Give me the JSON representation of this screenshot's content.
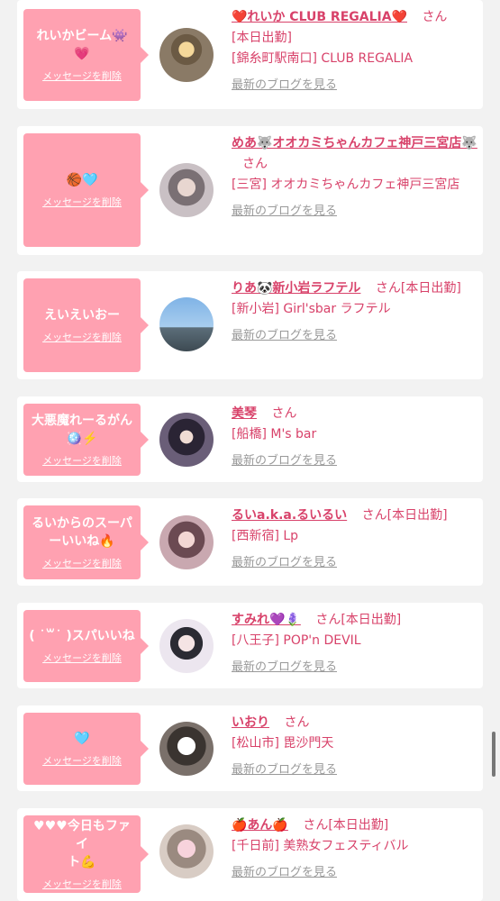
{
  "cards": [
    {
      "message": "れいかビーム👾\n💗",
      "delete": "メッセージを削除",
      "name": "❤️れいか CLUB REGALIA❤️",
      "san": "さん",
      "status": "",
      "extra": "[本日出勤]",
      "shop": "[錦糸町駅南口] CLUB REGALIA",
      "blog": "最新のブログを見る",
      "avatar": "avatar-1"
    },
    {
      "message": "🏀🩵",
      "delete": "メッセージを削除",
      "name": "めあ🐺オオカミちゃんカフェ神戸三宮店🐺",
      "san": "さん",
      "status": "",
      "extra": "",
      "shop": "[三宮] オオカミちゃんカフェ神戸三宮店",
      "blog": "最新のブログを見る",
      "avatar": "avatar-2"
    },
    {
      "message": "えいえいおー",
      "delete": "メッセージを削除",
      "name": "りあ🐼新小岩ラフテル",
      "san": "さん[本日出勤]",
      "status": "",
      "extra": "",
      "shop": "[新小岩] Girl'sbar ラフテル",
      "blog": "最新のブログを見る",
      "avatar": "avatar-3"
    },
    {
      "message": "大悪魔れーるがん\n🪩⚡️",
      "delete": "メッセージを削除",
      "name": "美琴",
      "san": "さん",
      "status": "",
      "extra": "",
      "shop": "[船橋] M's bar",
      "blog": "最新のブログを見る",
      "avatar": "avatar-4"
    },
    {
      "message": "るいからのスーパ\nーいいね🔥",
      "delete": "メッセージを削除",
      "name": "るいa.k.a.るいるい",
      "san": "さん[本日出勤]",
      "status": "",
      "extra": "",
      "shop": "[西新宿] Lp",
      "blog": "最新のブログを見る",
      "avatar": "avatar-5"
    },
    {
      "message": "( ˙꒳˙ )スパいいね",
      "delete": "メッセージを削除",
      "name": "すみれ💜🪻",
      "san": "さん[本日出勤]",
      "status": "",
      "extra": "",
      "shop": "[八王子] POP'n DEVIL",
      "blog": "最新のブログを見る",
      "avatar": "avatar-6"
    },
    {
      "message": "🩵",
      "delete": "メッセージを削除",
      "name": "いおり",
      "san": "さん",
      "status": "",
      "extra": "",
      "shop": "[松山市] 毘沙門天",
      "blog": "最新のブログを見る",
      "avatar": "avatar-7"
    },
    {
      "message": "♥♥♥今日もファイ\nト💪",
      "delete": "メッセージを削除",
      "name": "🍎あん🍎",
      "san": "さん[本日出勤]",
      "status": "",
      "extra": "",
      "shop": "[千日前] 美熟女フェスティバル",
      "blog": "最新のブログを見る",
      "avatar": "avatar-8"
    }
  ],
  "colors": {
    "accent": "#d8426a",
    "bubble": "#ffa1b1",
    "bg": "#f2f2f2"
  }
}
